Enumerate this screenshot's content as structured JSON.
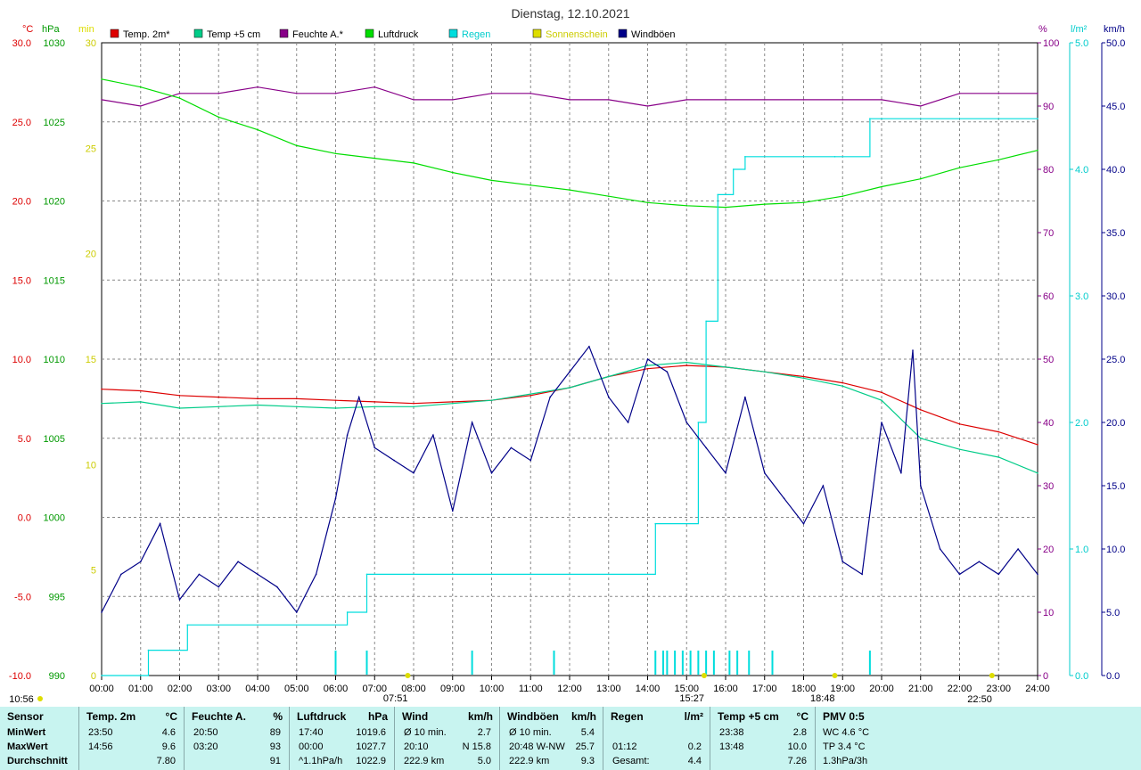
{
  "title": "Dienstag, 12.10.2021",
  "axis_units": {
    "temp": "°C",
    "press": "hPa",
    "sun": "min",
    "hum": "%",
    "rain": "l/m²",
    "wind": "km/h"
  },
  "legend": [
    {
      "label": "Temp. 2m*",
      "color": "#dd0000"
    },
    {
      "label": "Temp +5 cm",
      "color": "#00cc88"
    },
    {
      "label": "Feuchte A.*",
      "color": "#880088"
    },
    {
      "label": "Luftdruck",
      "color": "#00dd00"
    },
    {
      "label": "Regen",
      "color": "#00dddd"
    },
    {
      "label": "Sonnenschein",
      "color": "#dddd00"
    },
    {
      "label": "Windböen",
      "color": "#000088"
    }
  ],
  "x_ticks": [
    "00:00",
    "01:00",
    "02:00",
    "03:00",
    "04:00",
    "05:00",
    "06:00",
    "07:00",
    "08:00",
    "09:00",
    "10:00",
    "11:00",
    "12:00",
    "13:00",
    "14:00",
    "15:00",
    "16:00",
    "17:00",
    "18:00",
    "19:00",
    "20:00",
    "21:00",
    "22:00",
    "23:00",
    "24:00"
  ],
  "markers": [
    {
      "label": "10:56",
      "hour": -0.4
    },
    {
      "label": "07:51",
      "hour": 7.85
    },
    {
      "label": "15:27",
      "hour": 15.45
    },
    {
      "label": "18:48",
      "hour": 18.8
    },
    {
      "label": "22:50",
      "hour": 22.83
    }
  ],
  "chart_data": {
    "type": "line",
    "title": "Dienstag, 12.10.2021",
    "xlabel": "",
    "x_range": [
      0,
      24
    ],
    "axes": {
      "temp": {
        "unit": "°C",
        "range": [
          -10,
          30
        ],
        "ticks": [
          "30.0",
          "25.0",
          "20.0",
          "15.0",
          "10.0",
          "5.0",
          "0.0",
          "-5.0",
          "-10.0"
        ]
      },
      "press": {
        "unit": "hPa",
        "range": [
          990,
          1030
        ],
        "ticks": [
          "1030",
          "1025",
          "1020",
          "1015",
          "1010",
          "1005",
          "1000",
          "995",
          "990"
        ]
      },
      "sun": {
        "unit": "min",
        "range": [
          0,
          30
        ],
        "ticks": [
          "30",
          "25",
          "20",
          "15",
          "10",
          "5",
          "0"
        ]
      },
      "hum": {
        "unit": "%",
        "range": [
          0,
          100
        ],
        "ticks": [
          "100",
          "90",
          "80",
          "70",
          "60",
          "50",
          "40",
          "30",
          "20",
          "10",
          "0"
        ]
      },
      "rain": {
        "unit": "l/m²",
        "range": [
          0,
          5
        ],
        "ticks": [
          "5.0",
          "4.0",
          "3.0",
          "2.0",
          "1.0",
          "0.0"
        ]
      },
      "wind": {
        "unit": "km/h",
        "range": [
          0,
          50
        ],
        "ticks": [
          "50.0",
          "45.0",
          "40.0",
          "35.0",
          "30.0",
          "25.0",
          "20.0",
          "15.0",
          "10.0",
          "5.0",
          "0.0"
        ]
      }
    },
    "series": [
      {
        "name": "Temp. 2m*",
        "axis": "temp",
        "color": "#dd0000",
        "x": [
          0,
          1,
          2,
          3,
          4,
          5,
          6,
          7,
          8,
          9,
          10,
          11,
          12,
          13,
          14,
          15,
          16,
          17,
          18,
          19,
          20,
          21,
          22,
          23,
          24
        ],
        "y": [
          8.1,
          8.0,
          7.7,
          7.6,
          7.5,
          7.5,
          7.4,
          7.3,
          7.2,
          7.3,
          7.4,
          7.7,
          8.2,
          8.9,
          9.4,
          9.6,
          9.5,
          9.2,
          8.9,
          8.5,
          7.9,
          6.8,
          5.9,
          5.4,
          4.6
        ]
      },
      {
        "name": "Temp +5 cm",
        "axis": "temp",
        "color": "#00cc88",
        "x": [
          0,
          1,
          2,
          3,
          4,
          5,
          6,
          7,
          8,
          9,
          10,
          11,
          12,
          13,
          14,
          15,
          16,
          17,
          18,
          19,
          20,
          21,
          22,
          23,
          24
        ],
        "y": [
          7.2,
          7.3,
          6.9,
          7.0,
          7.1,
          7.0,
          6.9,
          7.0,
          7.0,
          7.2,
          7.4,
          7.8,
          8.2,
          8.9,
          9.6,
          9.8,
          9.5,
          9.2,
          8.8,
          8.3,
          7.4,
          5.0,
          4.3,
          3.8,
          2.8
        ]
      },
      {
        "name": "Feuchte A.*",
        "axis": "hum",
        "color": "#880088",
        "x": [
          0,
          1,
          2,
          3,
          4,
          5,
          6,
          7,
          8,
          9,
          10,
          11,
          12,
          13,
          14,
          15,
          16,
          17,
          18,
          19,
          20,
          21,
          22,
          23,
          24
        ],
        "y": [
          91,
          90,
          92,
          92,
          93,
          92,
          92,
          93,
          91,
          91,
          92,
          92,
          91,
          91,
          90,
          91,
          91,
          91,
          91,
          91,
          91,
          90,
          92,
          92,
          92
        ]
      },
      {
        "name": "Luftdruck",
        "axis": "press",
        "color": "#00dd00",
        "x": [
          0,
          1,
          2,
          3,
          4,
          5,
          6,
          7,
          8,
          9,
          10,
          11,
          12,
          13,
          14,
          15,
          16,
          17,
          18,
          19,
          20,
          21,
          22,
          23,
          24
        ],
        "y": [
          1027.7,
          1027.2,
          1026.5,
          1025.3,
          1024.5,
          1023.5,
          1023.0,
          1022.7,
          1022.4,
          1021.8,
          1021.3,
          1021.0,
          1020.7,
          1020.3,
          1019.9,
          1019.7,
          1019.6,
          1019.8,
          1019.9,
          1020.3,
          1020.9,
          1021.4,
          1022.1,
          1022.6,
          1023.2
        ]
      },
      {
        "name": "Regen",
        "axis": "rain",
        "color": "#00dddd",
        "step": true,
        "x": [
          0,
          1.2,
          2.2,
          6.3,
          6.8,
          14.2,
          15.3,
          15.5,
          15.8,
          16.2,
          16.5,
          18.8,
          19.7,
          20.0,
          24
        ],
        "y": [
          0.0,
          0.2,
          0.4,
          0.5,
          0.8,
          1.2,
          2.0,
          2.8,
          3.8,
          4.0,
          4.1,
          4.1,
          4.4,
          4.4,
          4.4
        ]
      },
      {
        "name": "Windböen",
        "axis": "wind",
        "color": "#000088",
        "x": [
          0,
          0.5,
          1,
          1.5,
          2,
          2.5,
          3,
          3.5,
          4,
          4.5,
          5,
          5.5,
          6,
          6.3,
          6.6,
          7,
          7.5,
          8,
          8.5,
          9,
          9.5,
          10,
          10.5,
          11,
          11.5,
          12,
          12.5,
          13,
          13.5,
          14,
          14.5,
          15,
          15.5,
          16,
          16.5,
          17,
          17.5,
          18,
          18.5,
          19,
          19.5,
          20,
          20.5,
          20.8,
          21,
          21.5,
          22,
          22.5,
          23,
          23.5,
          24
        ],
        "y": [
          5,
          8,
          9,
          12,
          6,
          8,
          7,
          9,
          8,
          7,
          5,
          8,
          14,
          19,
          22,
          18,
          17,
          16,
          19,
          13,
          20,
          16,
          18,
          17,
          22,
          24,
          26,
          22,
          20,
          25,
          24,
          20,
          18,
          16,
          22,
          16,
          14,
          12,
          15,
          9,
          8,
          20,
          16,
          25.7,
          15,
          10,
          8,
          9,
          8,
          10,
          8
        ]
      }
    ],
    "sun_markers_hours": [
      7.85,
      15.45,
      18.8,
      22.83
    ],
    "rain_ticks_hours": [
      6.0,
      6.8,
      9.5,
      11.6,
      14.2,
      14.4,
      14.5,
      14.7,
      14.9,
      15.1,
      15.3,
      15.5,
      15.7,
      16.1,
      16.3,
      16.6,
      17.2,
      19.7
    ]
  },
  "stats": {
    "columns": [
      {
        "header": "Sensor",
        "unit": ""
      },
      {
        "header": "Temp. 2m",
        "unit": "°C"
      },
      {
        "header": "Feuchte A.",
        "unit": "%"
      },
      {
        "header": "Luftdruck",
        "unit": "hPa"
      },
      {
        "header": "Wind",
        "unit": "km/h"
      },
      {
        "header": "Windböen",
        "unit": "km/h"
      },
      {
        "header": "Regen",
        "unit": "l/m²"
      },
      {
        "header": "Temp +5 cm",
        "unit": "°C"
      },
      {
        "header": "PMV 0:5",
        "unit": ""
      }
    ],
    "row_labels": [
      "MinWert",
      "MaxWert",
      "Durchschnitt"
    ],
    "temp": [
      [
        "23:50",
        "4.6"
      ],
      [
        "14:56",
        "9.6"
      ],
      [
        "",
        "7.80"
      ]
    ],
    "hum": [
      [
        "20:50",
        "89"
      ],
      [
        "03:20",
        "93"
      ],
      [
        "",
        "91"
      ]
    ],
    "press": [
      [
        "17:40",
        "1019.6"
      ],
      [
        "00:00",
        "1027.7"
      ],
      [
        "^1.1hPa/h",
        "1022.9"
      ]
    ],
    "wind": [
      [
        "Ø 10 min.",
        "2.7"
      ],
      [
        "20:10",
        "N 15.8"
      ],
      [
        "222.9 km",
        "5.0"
      ]
    ],
    "gust": [
      [
        "Ø 10 min.",
        "5.4"
      ],
      [
        "20:48  W-NW",
        "25.7"
      ],
      [
        "222.9 km",
        "9.3"
      ]
    ],
    "rain": [
      [
        "",
        ""
      ],
      [
        "01:12",
        "0.2"
      ],
      [
        "Gesamt:",
        "4.4"
      ]
    ],
    "temp5": [
      [
        "23:38",
        "2.8"
      ],
      [
        "13:48",
        "10.0"
      ],
      [
        "",
        "7.26"
      ]
    ],
    "pmv": [
      "WC 4.6 °C",
      "TP 3.4 °C",
      "1.3hPa/3h"
    ]
  }
}
